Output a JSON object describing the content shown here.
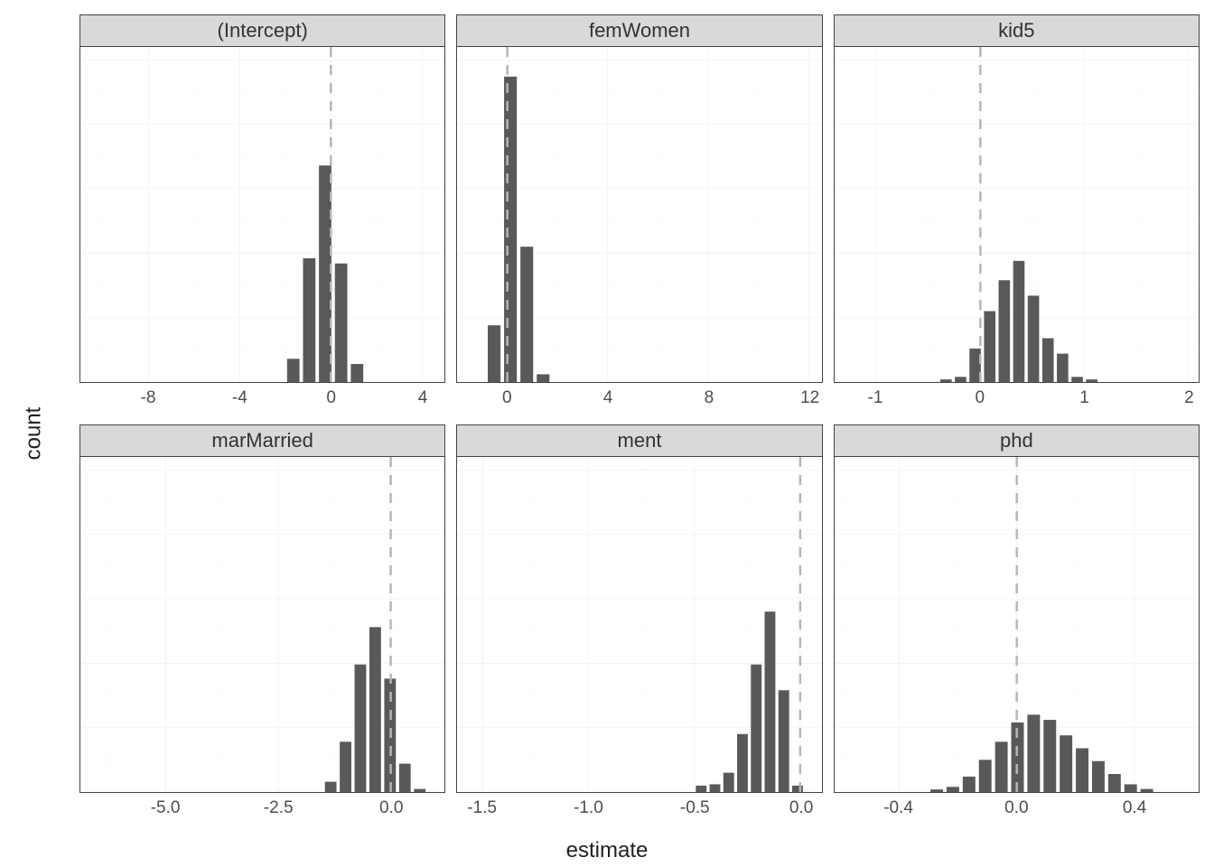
{
  "axis_labels": {
    "x": "estimate",
    "y": "count"
  },
  "y": {
    "min": 0,
    "max": 1300,
    "ticks_major": [
      0,
      250,
      500,
      750,
      1000,
      1250
    ],
    "ticks_minor": [
      125,
      375,
      625,
      875,
      1125
    ]
  },
  "facets": [
    {
      "id": "intercept",
      "title": "(Intercept)",
      "row": 0,
      "col": 0,
      "x": {
        "min": -11,
        "max": 5,
        "ticks_major": [
          -8,
          -4,
          0,
          4
        ],
        "ticks_minor": [
          -10,
          -6,
          -2,
          2
        ]
      },
      "vline": 0,
      "bars": [
        {
          "x": -2.0,
          "w": 0.7,
          "count": 90
        },
        {
          "x": -1.3,
          "w": 0.7,
          "count": 480
        },
        {
          "x": -0.6,
          "w": 0.7,
          "count": 840
        },
        {
          "x": 0.1,
          "w": 0.7,
          "count": 460
        },
        {
          "x": 0.8,
          "w": 0.7,
          "count": 70
        }
      ]
    },
    {
      "id": "femwomen",
      "title": "femWomen",
      "row": 0,
      "col": 1,
      "x": {
        "min": -2,
        "max": 12.5,
        "ticks_major": [
          0,
          4,
          8,
          12
        ],
        "ticks_minor": [
          2,
          6,
          10
        ]
      },
      "vline": 0,
      "bars": [
        {
          "x": -0.85,
          "w": 0.65,
          "count": 220
        },
        {
          "x": -0.2,
          "w": 0.65,
          "count": 1185
        },
        {
          "x": 0.45,
          "w": 0.65,
          "count": 525
        },
        {
          "x": 1.1,
          "w": 0.65,
          "count": 30
        }
      ]
    },
    {
      "id": "kid5",
      "title": "kid5",
      "row": 0,
      "col": 2,
      "x": {
        "min": -1.4,
        "max": 2.1,
        "ticks_major": [
          -1,
          0,
          1,
          2
        ],
        "ticks_minor": [
          -0.5,
          0.5,
          1.5
        ]
      },
      "vline": 0,
      "bars": [
        {
          "x": -0.4,
          "w": 0.14,
          "count": 10
        },
        {
          "x": -0.26,
          "w": 0.14,
          "count": 20
        },
        {
          "x": -0.12,
          "w": 0.14,
          "count": 130
        },
        {
          "x": 0.02,
          "w": 0.14,
          "count": 275
        },
        {
          "x": 0.16,
          "w": 0.14,
          "count": 395
        },
        {
          "x": 0.3,
          "w": 0.14,
          "count": 470
        },
        {
          "x": 0.44,
          "w": 0.14,
          "count": 335
        },
        {
          "x": 0.58,
          "w": 0.14,
          "count": 170
        },
        {
          "x": 0.72,
          "w": 0.14,
          "count": 110
        },
        {
          "x": 0.86,
          "w": 0.14,
          "count": 20
        },
        {
          "x": 1.0,
          "w": 0.14,
          "count": 10
        }
      ]
    },
    {
      "id": "marmarried",
      "title": "marMarried",
      "row": 1,
      "col": 0,
      "x": {
        "min": -6.9,
        "max": 1.2,
        "ticks_major": [
          -5.0,
          -2.5,
          0.0
        ],
        "ticks_minor": [
          -6.25,
          -3.75,
          -1.25,
          1.25
        ],
        "fmt": "0.1"
      },
      "vline": 0,
      "bars": [
        {
          "x": -1.5,
          "w": 0.33,
          "count": 40
        },
        {
          "x": -1.17,
          "w": 0.33,
          "count": 195
        },
        {
          "x": -0.84,
          "w": 0.33,
          "count": 495
        },
        {
          "x": -0.51,
          "w": 0.33,
          "count": 640
        },
        {
          "x": -0.18,
          "w": 0.33,
          "count": 440
        },
        {
          "x": 0.15,
          "w": 0.33,
          "count": 110
        },
        {
          "x": 0.48,
          "w": 0.33,
          "count": 12
        }
      ]
    },
    {
      "id": "ment",
      "title": "ment",
      "row": 1,
      "col": 1,
      "x": {
        "min": -1.62,
        "max": 0.1,
        "ticks_major": [
          -1.5,
          -1.0,
          -0.5,
          0.0
        ],
        "ticks_minor": [
          -1.25,
          -0.75,
          -0.25
        ],
        "fmt": "0.1"
      },
      "vline": 0,
      "bars": [
        {
          "x": -0.5,
          "w": 0.065,
          "count": 25
        },
        {
          "x": -0.435,
          "w": 0.065,
          "count": 30
        },
        {
          "x": -0.37,
          "w": 0.065,
          "count": 75
        },
        {
          "x": -0.305,
          "w": 0.065,
          "count": 225
        },
        {
          "x": -0.24,
          "w": 0.065,
          "count": 495
        },
        {
          "x": -0.175,
          "w": 0.065,
          "count": 700
        },
        {
          "x": -0.11,
          "w": 0.065,
          "count": 395
        },
        {
          "x": -0.045,
          "w": 0.065,
          "count": 25
        }
      ]
    },
    {
      "id": "phd",
      "title": "phd",
      "row": 1,
      "col": 2,
      "x": {
        "min": -0.62,
        "max": 0.62,
        "ticks_major": [
          -0.4,
          0.0,
          0.4
        ],
        "ticks_minor": [
          -0.6,
          -0.2,
          0.2,
          0.6
        ],
        "fmt": "0.1"
      },
      "vline": 0,
      "bars": [
        {
          "x": -0.3,
          "w": 0.055,
          "count": 10
        },
        {
          "x": -0.245,
          "w": 0.055,
          "count": 20
        },
        {
          "x": -0.19,
          "w": 0.055,
          "count": 60
        },
        {
          "x": -0.135,
          "w": 0.055,
          "count": 125
        },
        {
          "x": -0.08,
          "w": 0.055,
          "count": 195
        },
        {
          "x": -0.025,
          "w": 0.055,
          "count": 270
        },
        {
          "x": 0.03,
          "w": 0.055,
          "count": 300
        },
        {
          "x": 0.085,
          "w": 0.055,
          "count": 280
        },
        {
          "x": 0.14,
          "w": 0.055,
          "count": 220
        },
        {
          "x": 0.195,
          "w": 0.055,
          "count": 170
        },
        {
          "x": 0.25,
          "w": 0.055,
          "count": 120
        },
        {
          "x": 0.305,
          "w": 0.055,
          "count": 70
        },
        {
          "x": 0.36,
          "w": 0.055,
          "count": 30
        },
        {
          "x": 0.415,
          "w": 0.055,
          "count": 12
        }
      ]
    }
  ],
  "chart_data": [
    {
      "type": "bar",
      "facet": "(Intercept)",
      "xlabel": "estimate",
      "ylabel": "count",
      "xlim": [
        -11,
        5
      ],
      "ylim": [
        0,
        1300
      ],
      "vline_x": 0,
      "x": [
        -2.0,
        -1.3,
        -0.6,
        0.1,
        0.8
      ],
      "values": [
        90,
        480,
        840,
        460,
        70
      ]
    },
    {
      "type": "bar",
      "facet": "femWomen",
      "xlabel": "estimate",
      "ylabel": "count",
      "xlim": [
        -2,
        12.5
      ],
      "ylim": [
        0,
        1300
      ],
      "vline_x": 0,
      "x": [
        -0.85,
        -0.2,
        0.45,
        1.1
      ],
      "values": [
        220,
        1185,
        525,
        30
      ]
    },
    {
      "type": "bar",
      "facet": "kid5",
      "xlabel": "estimate",
      "ylabel": "count",
      "xlim": [
        -1.4,
        2.1
      ],
      "ylim": [
        0,
        1300
      ],
      "vline_x": 0,
      "x": [
        -0.4,
        -0.26,
        -0.12,
        0.02,
        0.16,
        0.3,
        0.44,
        0.58,
        0.72,
        0.86,
        1.0
      ],
      "values": [
        10,
        20,
        130,
        275,
        395,
        470,
        335,
        170,
        110,
        20,
        10
      ]
    },
    {
      "type": "bar",
      "facet": "marMarried",
      "xlabel": "estimate",
      "ylabel": "count",
      "xlim": [
        -6.9,
        1.2
      ],
      "ylim": [
        0,
        1300
      ],
      "vline_x": 0,
      "x": [
        -1.5,
        -1.17,
        -0.84,
        -0.51,
        -0.18,
        0.15,
        0.48
      ],
      "values": [
        40,
        195,
        495,
        640,
        440,
        110,
        12
      ]
    },
    {
      "type": "bar",
      "facet": "ment",
      "xlabel": "estimate",
      "ylabel": "count",
      "xlim": [
        -1.62,
        0.1
      ],
      "ylim": [
        0,
        1300
      ],
      "vline_x": 0,
      "x": [
        -0.5,
        -0.435,
        -0.37,
        -0.305,
        -0.24,
        -0.175,
        -0.11,
        -0.045
      ],
      "values": [
        25,
        30,
        75,
        225,
        495,
        700,
        395,
        25
      ]
    },
    {
      "type": "bar",
      "facet": "phd",
      "xlabel": "estimate",
      "ylabel": "count",
      "xlim": [
        -0.62,
        0.62
      ],
      "ylim": [
        0,
        1300
      ],
      "vline_x": 0,
      "x": [
        -0.3,
        -0.245,
        -0.19,
        -0.135,
        -0.08,
        -0.025,
        0.03,
        0.085,
        0.14,
        0.195,
        0.25,
        0.305,
        0.36,
        0.415
      ],
      "values": [
        10,
        20,
        60,
        125,
        195,
        270,
        300,
        280,
        220,
        170,
        120,
        70,
        30,
        12
      ]
    }
  ]
}
